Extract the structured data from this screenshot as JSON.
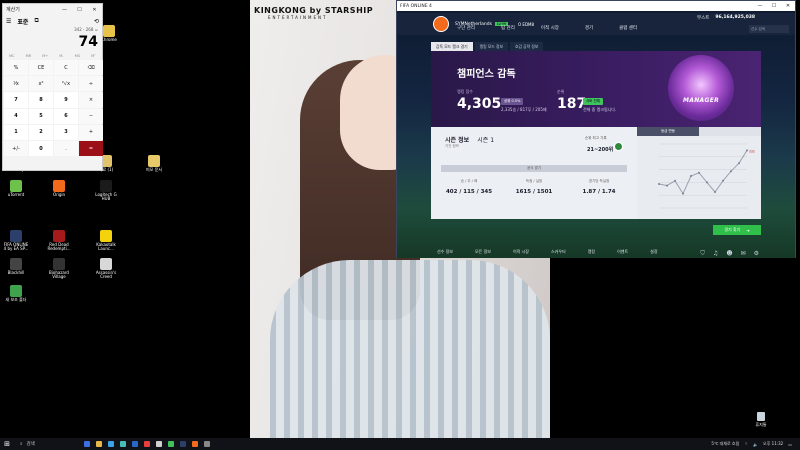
{
  "calculator": {
    "title": "계산기",
    "mode": "표준",
    "expression": "342 - 268 =",
    "display": "74",
    "memory": [
      "MC",
      "MR",
      "M+",
      "M-",
      "MS",
      "M˅"
    ],
    "keys": [
      "%",
      "CE",
      "C",
      "⌫",
      "⅟x",
      "x²",
      "²√x",
      "÷",
      "7",
      "8",
      "9",
      "×",
      "4",
      "5",
      "6",
      "−",
      "1",
      "2",
      "3",
      "+",
      "+/-",
      "0",
      ".",
      "="
    ]
  },
  "desktop_icons": [
    {
      "label": "Chrome",
      "color": "#e8c34a"
    },
    {
      "label": "uTorrent",
      "color": "#6cc24a"
    },
    {
      "label": "Origin",
      "color": "#f26a1b"
    },
    {
      "label": "Logitech G HUB",
      "color": "#1b1b1b"
    },
    {
      "label": "FIFA ONLINE 4 by EA SP...",
      "color": "#2b3f6a"
    },
    {
      "label": "Red Dead Redempti...",
      "color": "#a51b1b"
    },
    {
      "label": "Kakaotalk Launc...",
      "color": "#f5d30c"
    },
    {
      "label": "Blackhill",
      "color": "#444"
    },
    {
      "label": "Biohazard Village",
      "color": "#333"
    },
    {
      "label": "Assassin's Creed",
      "color": "#d8d8d8"
    },
    {
      "label": "새 보조 폴더",
      "color": "#3fa34d"
    },
    {
      "label": "자료 (1)",
      "color": "#e0c36a"
    },
    {
      "label": "Cleanup",
      "color": "#7d8aa8"
    },
    {
      "label": "미모 문서",
      "color": "#e7c96a"
    }
  ],
  "wallpaper": {
    "brand": "KINGKONG by STARSHIP",
    "brand_sub": "ENTERTAINMENT"
  },
  "fifa": {
    "window_title": "FIFA ONLINE 4",
    "team_name": "SYMNetherlands",
    "team_badge": "LV.99",
    "club": "Ο EDM8",
    "menus": [
      "구단 관리",
      "팀 관리",
      "이적 시장",
      "경기",
      "클럽 센터"
    ],
    "coins": [
      "무스트",
      "96,164,925,038"
    ],
    "search_placeholder": "선수 검색",
    "subtabs": [
      "감독 모드 랭크 경기",
      "랭킹 모드 정보",
      "호감 공략 정보"
    ],
    "card": {
      "title": "챔피언스 감독",
      "score_label": "랭킹 점수",
      "score": "4,305",
      "score_pill": "상위 0.5%",
      "score_detail": "2,335승 / 817무 / 205패",
      "rank_label": "순위",
      "rank": "187",
      "rank_pill": "서버 전체",
      "rank_detail": "전체 중 랭크됩니다.",
      "medal_text": "MANAGER",
      "season_title": "시즌 정보",
      "season_num": "시즌 1",
      "season_sub": "기간 정보",
      "best_rank_label": "순위 최고 기록",
      "best_rank": "21~200위",
      "record_bar": "공식 경기",
      "stats": [
        {
          "label": "승 / 무 / 패",
          "value": "402 / 115 / 345"
        },
        {
          "label": "득점 / 실점",
          "value": "1615 / 1501"
        },
        {
          "label": "경기당 득실점",
          "value": "1.87 / 1.74"
        }
      ],
      "graph_tab": "등급 변동"
    },
    "cta": "경기 찾기",
    "bottom_nav": [
      "선수 정보",
      "모든 정보",
      "이적 시장",
      "스카우터",
      "랭킹",
      "이벤트",
      "설정"
    ]
  },
  "taskbar": {
    "start": "⊞",
    "search": "검색",
    "tray": [
      "5℃ 대체로 흐림",
      "오후 11:32"
    ]
  },
  "recycle_bin": "휴지통",
  "chart_data": {
    "type": "line",
    "title": "등급 변동",
    "series": [
      {
        "values": [
          3250,
          3200,
          3350,
          2950,
          3500,
          3600,
          3300,
          3000,
          3350,
          3650,
          3900,
          4300
        ]
      }
    ],
    "ylim": [
      2500,
      4500
    ],
    "annotations": [
      "최대"
    ]
  }
}
